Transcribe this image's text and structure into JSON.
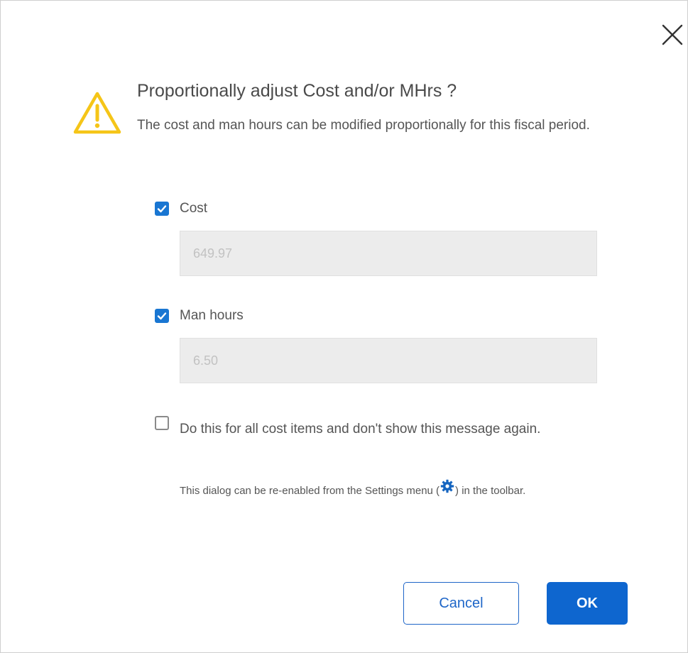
{
  "dialog": {
    "title": "Proportionally adjust Cost and/or MHrs ?",
    "description": "The cost and man hours can be modified proportionally for this fiscal period.",
    "close_icon": "close-icon",
    "warning_icon": "warning-triangle-icon"
  },
  "fields": {
    "cost": {
      "label": "Cost",
      "checked": true,
      "placeholder": "649.97"
    },
    "man_hours": {
      "label": "Man hours",
      "checked": true,
      "placeholder": "6.50"
    }
  },
  "apply_all": {
    "checked": false,
    "label": "Do this for all cost items and don't show this message again.",
    "hint_before": "This dialog can be re-enabled from the Settings menu (",
    "hint_icon": "settings-gear-icon",
    "hint_after": ") in the toolbar."
  },
  "buttons": {
    "cancel": "Cancel",
    "ok": "OK"
  },
  "colors": {
    "accent": "#1976d2",
    "primary_button": "#0e66cf",
    "warning": "#f5c518",
    "disabled_field": "#ececec"
  }
}
